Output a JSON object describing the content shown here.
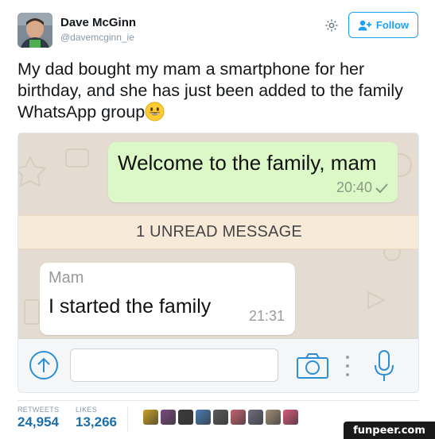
{
  "profile": {
    "name": "Dave McGinn",
    "handle": "@davemcginn_ie",
    "follow_label": "Follow"
  },
  "tweet": {
    "text": "My dad bought my mam a smartphone for her birthday, and she has just been added to the family WhatsApp group",
    "emoji_icon": "grinning-face-emoji"
  },
  "chat": {
    "outgoing": {
      "text": "Welcome to the family, mam",
      "time": "20:40"
    },
    "unread_banner": "1 UNREAD MESSAGE",
    "incoming": {
      "sender": "Mam",
      "text": "I started the family",
      "time": "21:31"
    },
    "input": {
      "value": "",
      "placeholder": ""
    }
  },
  "stats": {
    "retweets_label": "RETWEETS",
    "retweets_value": "24,954",
    "likes_label": "LIKES",
    "likes_value": "13,266",
    "liker_colors": [
      "#c9a227",
      "#7a4a7e",
      "#3b3b3b",
      "#4a7bb3",
      "#5a5a5a",
      "#c4646f",
      "#6e6e80",
      "#a18e75",
      "#d55a7a"
    ]
  },
  "watermark": "funpeer.com",
  "colors": {
    "accent": "#1da1f2",
    "stat_value": "#1b6fab",
    "chat_out": "#dcf8c6",
    "chat_in": "#ffffff",
    "chat_bg": "#e5dcd1",
    "unread_bg": "#f7ead8",
    "whatsapp_blue": "#2b8fd6"
  }
}
